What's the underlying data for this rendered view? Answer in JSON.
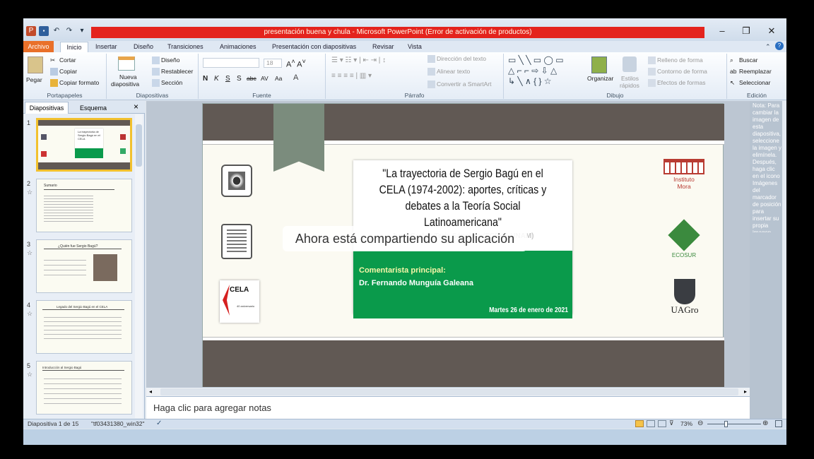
{
  "window": {
    "title": "presentación buena y chula - Microsoft PowerPoint (Error de activación de productos)",
    "min": "–",
    "max": "❐",
    "close": "✕",
    "accent_band": "#e4231d"
  },
  "qat": {
    "icons": [
      "P",
      "💾",
      "↶",
      "↷",
      "▾"
    ]
  },
  "tabs": [
    "Archivo",
    "Inicio",
    "Insertar",
    "Diseño",
    "Transiciones",
    "Animaciones",
    "Presentación con diapositivas",
    "Revisar",
    "Vista"
  ],
  "ribbon": {
    "portapapeles": {
      "pegar": "Pegar",
      "cortar": "Cortar",
      "copiar": "Copiar",
      "copiar_formato": "Copiar formato",
      "label": "Portapapeles"
    },
    "diapositivas": {
      "nueva": "Nueva",
      "nueva2": "diapositiva",
      "diseno": "Diseño",
      "restablecer": "Restablecer",
      "seccion": "Sección",
      "label": "Diapositivas"
    },
    "fuente": {
      "size": "18",
      "label": "Fuente",
      "bold": "N",
      "italic": "K",
      "underline": "S",
      "strike": "S",
      "abc": "abc",
      "spacing": "AV",
      "aa": "Aa",
      "a": "A"
    },
    "parrafo": {
      "direccion": "Dirección del texto",
      "alinear": "Alinear texto",
      "convertir": "Convertir a SmartArt",
      "label": "Párrafo"
    },
    "dibujo": {
      "organizar": "Organizar",
      "estilos": "Estilos",
      "estilos2": "rápidos",
      "relleno": "Relleno de forma",
      "contorno": "Contorno de forma",
      "efectos": "Efectos de formas",
      "label": "Dibujo"
    },
    "edicion": {
      "buscar": "Buscar",
      "reemplazar": "Reemplazar",
      "seleccionar": "Seleccionar",
      "label": "Edición"
    }
  },
  "left_pane": {
    "tabs": [
      "Diapositivas",
      "Esquema"
    ],
    "close": "×",
    "slides": [
      {
        "num": "1",
        "title": "La trayectoria de Sergio Bagú en el CELA"
      },
      {
        "num": "2",
        "title": "Sumario"
      },
      {
        "num": "3",
        "title": "¿Quién fue Sergio Bagú?"
      },
      {
        "num": "4",
        "title": "Legado del Sergio Bagú en el CELA"
      },
      {
        "num": "5",
        "title": "Introducción al Sergio Bagú"
      }
    ]
  },
  "slide": {
    "title": "\"La trayectoria de Sergio Bagú en el CELA (1974-2002): aportes, críticas y debates a la Teoría Social Latinoamericana\"",
    "author": "Juan Carlos Teriz Sánchez (FCPyS-UNAM)",
    "commentator_label": "Comentarista principal:",
    "commentator": "Dr. Fernando Munguía Galeana",
    "date": "Martes 26 de enero de 2021",
    "cela": "CELA",
    "cela_sub": "40 aniversario",
    "mora": "Instituto Mora",
    "ecosur": "ECOSUR",
    "uagro": "UAGro"
  },
  "right_pane": {
    "text": "Nota: Para cambiar la imagen de esta diapositiva, seleccione la imagen y elimínela. Después, haga clic en el icono Imágenes del marcador de posición para insertar su propia imagen."
  },
  "notes": {
    "placeholder": "Haga clic para agregar notas"
  },
  "status": {
    "slide": "Diapositiva 1 de 15",
    "theme": "\"tf03431380_win32\"",
    "zoom": "73%",
    "zoom_value": 73
  },
  "overlay": {
    "text": "Ahora está compartiendo su aplicación"
  }
}
